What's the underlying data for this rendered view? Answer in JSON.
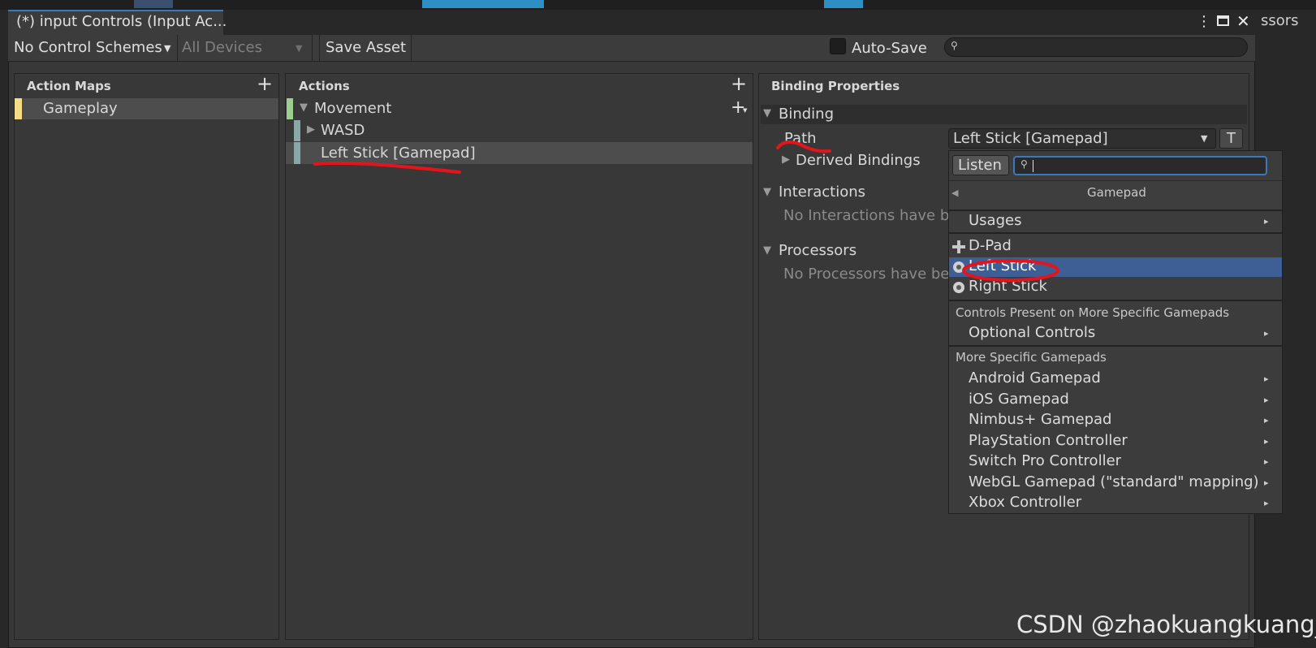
{
  "window": {
    "title": "(*) input Controls (Input Ac...",
    "menu_icon": "kebab-menu-icon",
    "maximize_icon": "maximize-icon",
    "close_icon": "close-icon",
    "background_partial_text": "ssors"
  },
  "toolbar": {
    "control_schemes": "No Control Schemes",
    "devices": "All Devices",
    "save_asset": "Save Asset",
    "auto_save": "Auto-Save",
    "search_placeholder": ""
  },
  "action_maps": {
    "header": "Action Maps",
    "items": [
      {
        "label": "Gameplay",
        "color": "#f5dc86"
      }
    ]
  },
  "actions": {
    "header": "Actions",
    "items": [
      {
        "label": "Movement",
        "color": "#9ccf8f"
      },
      {
        "label": "WASD",
        "color": "#88a8a8"
      },
      {
        "label": "Left Stick [Gamepad]",
        "color": "#88a8a8"
      }
    ]
  },
  "binding_properties": {
    "header": "Binding Properties",
    "binding_section": "Binding",
    "path_label": "Path",
    "path_value": "Left Stick [Gamepad]",
    "t_button": "T",
    "derived_bindings": "Derived Bindings",
    "interactions_section": "Interactions",
    "interactions_empty": "No Interactions have be",
    "processors_section": "Processors",
    "processors_empty": "No Processors have be"
  },
  "dropdown": {
    "listen_button": "Listen",
    "search_value": "",
    "header": "Gamepad",
    "usages": "Usages",
    "controls": [
      {
        "label": "D-Pad",
        "icon": "dpad-icon"
      },
      {
        "label": "Left Stick",
        "icon": "stick-icon",
        "selected": true
      },
      {
        "label": "Right Stick",
        "icon": "stick-icon"
      }
    ],
    "section_specific_controls": "Controls Present on More Specific Gamepads",
    "optional_controls": "Optional Controls",
    "section_specific_gamepads": "More Specific Gamepads",
    "gamepads": [
      "Android Gamepad",
      "iOS Gamepad",
      "Nimbus+ Gamepad",
      "PlayStation Controller",
      "Switch Pro Controller",
      "WebGL Gamepad (\"standard\" mapping)",
      "Xbox Controller"
    ]
  },
  "watermark": "CSDN @zhaokuangkuang_",
  "colors": {
    "accent_selected": "#3e5f96",
    "annotation": "#e3151c",
    "search_focus": "#3a79bb"
  }
}
